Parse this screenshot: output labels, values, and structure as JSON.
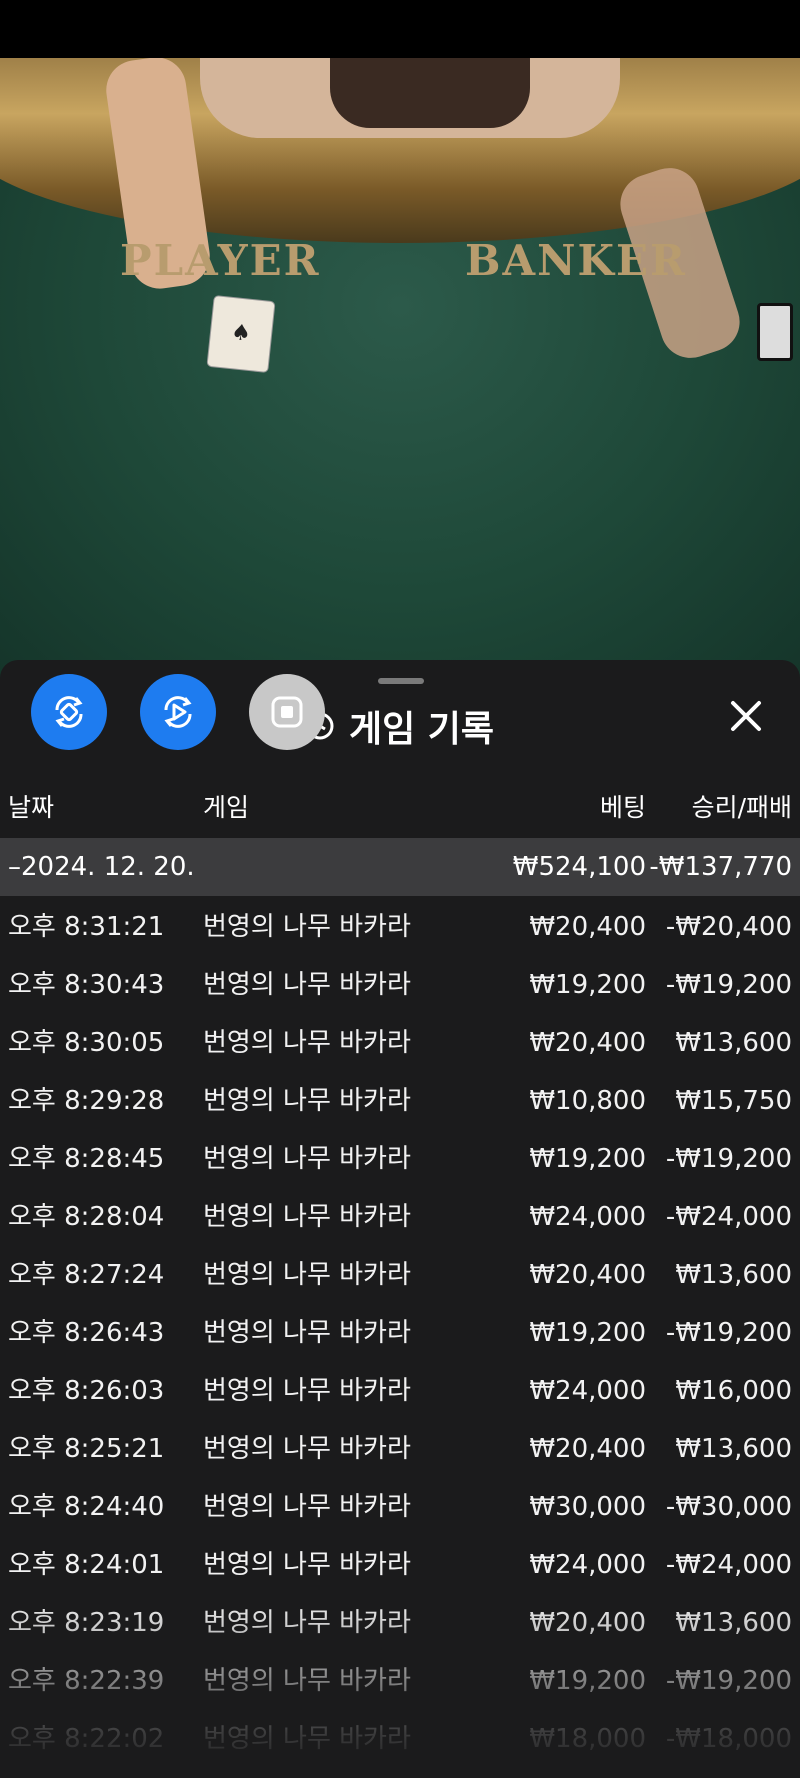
{
  "video": {
    "player_label": "PLAYER",
    "banker_label": "BANKER",
    "card_glyph": "♠"
  },
  "panel": {
    "title": "게임 기록",
    "buttons": [
      {
        "icon": "rotate-icon",
        "color": "#1e7cf0"
      },
      {
        "icon": "replay-icon",
        "color": "#1e7cf0"
      },
      {
        "icon": "stop-icon",
        "color": "#c8c8c8"
      }
    ],
    "title_icon": "history-icon",
    "close_icon": "close-icon"
  },
  "table": {
    "headers": {
      "date": "날짜",
      "game": "게임",
      "bet": "베팅",
      "win_loss": "승리/패배"
    },
    "summary": {
      "date": "–2024. 12. 20.",
      "bet": "₩524,100",
      "win_loss": "-₩137,770"
    },
    "rows": [
      {
        "time": "오후 8:31:21",
        "game": "번영의 나무 바카라",
        "bet": "₩20,400",
        "win_loss": "-₩20,400"
      },
      {
        "time": "오후 8:30:43",
        "game": "번영의 나무 바카라",
        "bet": "₩19,200",
        "win_loss": "-₩19,200"
      },
      {
        "time": "오후 8:30:05",
        "game": "번영의 나무 바카라",
        "bet": "₩20,400",
        "win_loss": "₩13,600"
      },
      {
        "time": "오후 8:29:28",
        "game": "번영의 나무 바카라",
        "bet": "₩10,800",
        "win_loss": "₩15,750"
      },
      {
        "time": "오후 8:28:45",
        "game": "번영의 나무 바카라",
        "bet": "₩19,200",
        "win_loss": "-₩19,200"
      },
      {
        "time": "오후 8:28:04",
        "game": "번영의 나무 바카라",
        "bet": "₩24,000",
        "win_loss": "-₩24,000"
      },
      {
        "time": "오후 8:27:24",
        "game": "번영의 나무 바카라",
        "bet": "₩20,400",
        "win_loss": "₩13,600"
      },
      {
        "time": "오후 8:26:43",
        "game": "번영의 나무 바카라",
        "bet": "₩19,200",
        "win_loss": "-₩19,200"
      },
      {
        "time": "오후 8:26:03",
        "game": "번영의 나무 바카라",
        "bet": "₩24,000",
        "win_loss": "₩16,000"
      },
      {
        "time": "오후 8:25:21",
        "game": "번영의 나무 바카라",
        "bet": "₩20,400",
        "win_loss": "₩13,600"
      },
      {
        "time": "오후 8:24:40",
        "game": "번영의 나무 바카라",
        "bet": "₩30,000",
        "win_loss": "-₩30,000"
      },
      {
        "time": "오후 8:24:01",
        "game": "번영의 나무 바카라",
        "bet": "₩24,000",
        "win_loss": "-₩24,000"
      },
      {
        "time": "오후 8:23:19",
        "game": "번영의 나무 바카라",
        "bet": "₩20,400",
        "win_loss": "₩13,600"
      },
      {
        "time": "오후 8:22:39",
        "game": "번영의 나무 바카라",
        "bet": "₩19,200",
        "win_loss": "-₩19,200"
      },
      {
        "time": "오후 8:22:02",
        "game": "번영의 나무 바카라",
        "bet": "₩18,000",
        "win_loss": "-₩18,000"
      }
    ]
  }
}
